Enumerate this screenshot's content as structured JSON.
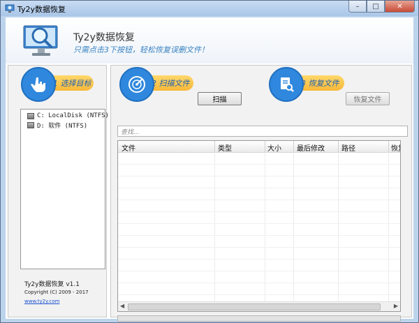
{
  "window": {
    "title": "Ty2y数据恢复",
    "minimize": "–",
    "maximize": "□",
    "close": "✕"
  },
  "header": {
    "app_name": "Ty2y数据恢复",
    "tagline": "只需点击3下按钮，轻松恢复误删文件！",
    "logo_icon": "magnifier-monitor-icon"
  },
  "steps": {
    "select": {
      "label": "1 选择目标",
      "icon": "hand-pointer-icon"
    },
    "scan": {
      "label": "2 扫描文件",
      "icon": "radar-scan-icon",
      "button": "扫描"
    },
    "recover": {
      "label": "3 恢复文件",
      "icon": "document-search-icon",
      "button": "恢复文件"
    }
  },
  "drives": [
    {
      "label": "C: LocalDisk (NTFS)"
    },
    {
      "label": "D: 软件 (NTFS)"
    }
  ],
  "footer": {
    "version": "Ty2y数据恢复 v1.1",
    "copyright": "Copyright (C) 2009 - 2017",
    "website": "www.ty2y.com"
  },
  "search": {
    "placeholder": "查找..."
  },
  "table": {
    "columns": [
      "文件",
      "类型",
      "大小",
      "最后修改",
      "路径",
      "恢复"
    ],
    "rows": []
  },
  "progress": {
    "value": 0
  },
  "colors": {
    "accent": "#2f88dd",
    "pill": "#f7b83a",
    "tagline": "#3a83c3"
  }
}
